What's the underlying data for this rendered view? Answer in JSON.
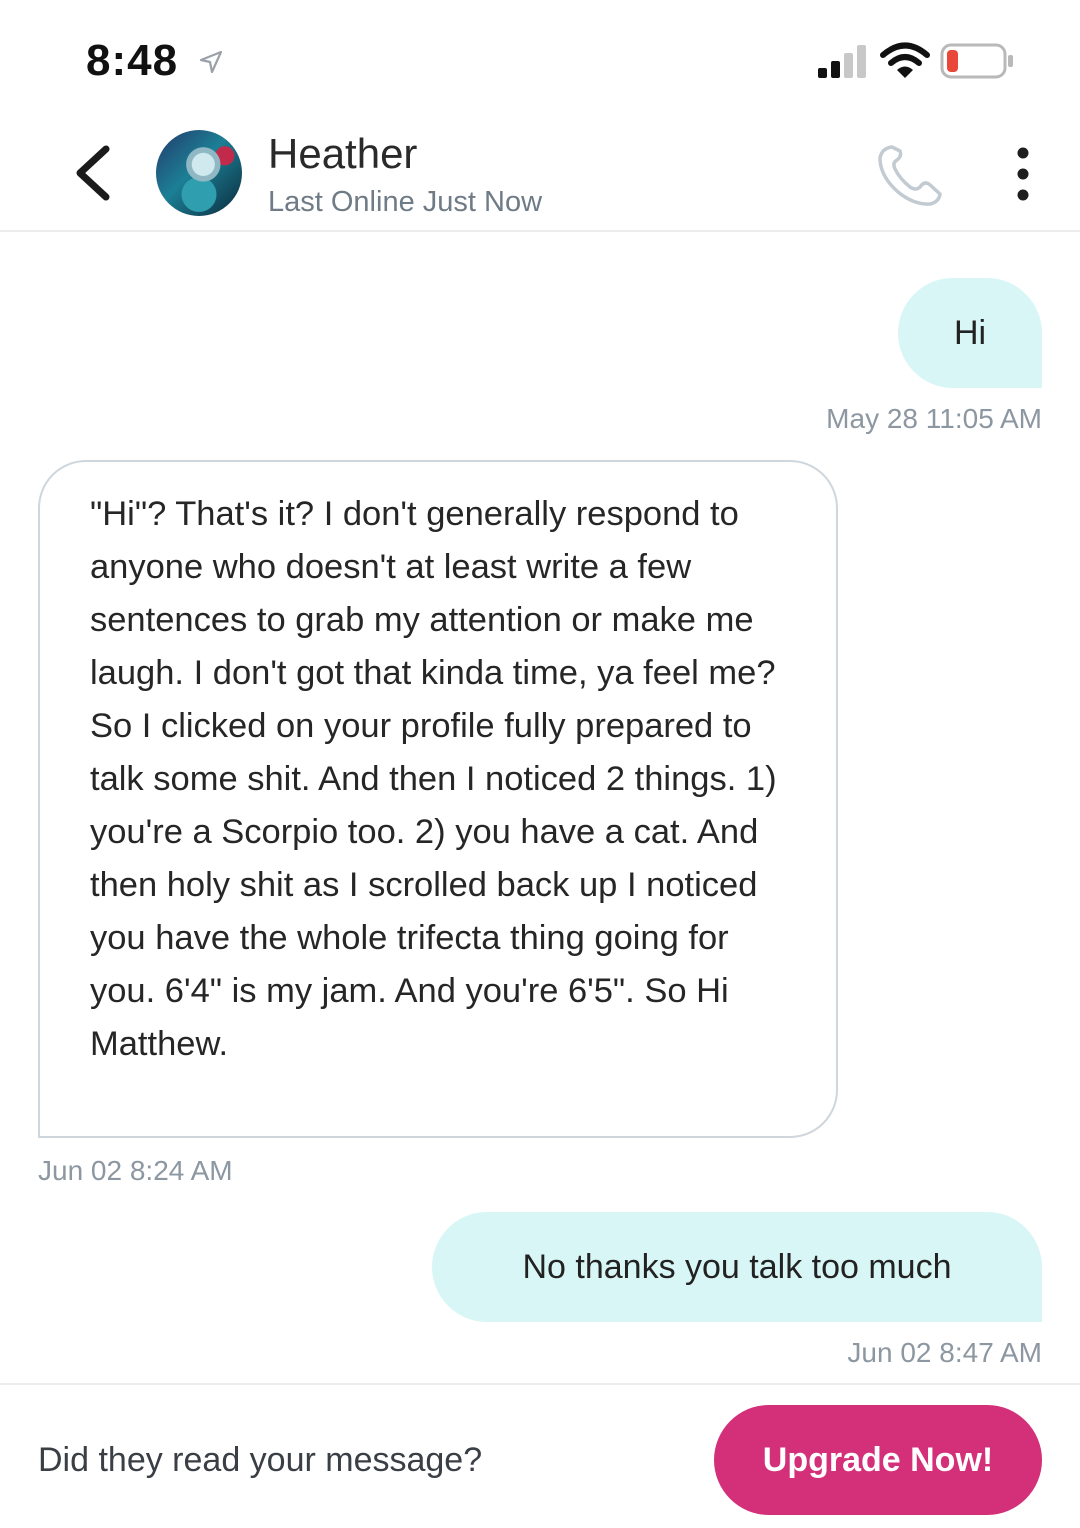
{
  "status_bar": {
    "time": "8:48",
    "icons": [
      "location-arrow-icon",
      "cell-signal-icon",
      "wifi-icon",
      "battery-low-icon"
    ],
    "battery_color": "#e8473a"
  },
  "header": {
    "contact_name": "Heather",
    "contact_status": "Last Online Just Now",
    "icons": [
      "back-chevron-icon",
      "avatar",
      "phone-icon",
      "more-vertical-icon"
    ]
  },
  "messages": [
    {
      "direction": "outgoing",
      "text": "Hi",
      "timestamp": "May 28 11:05 AM"
    },
    {
      "direction": "incoming",
      "text": "\"Hi\"? That's it? I don't generally respond to anyone who doesn't at least write a few sentences to grab my attention or make me laugh. I don't got that kinda time, ya feel me? So I clicked on your profile fully prepared to talk some shit. And then I noticed 2 things. 1) you're a Scorpio too. 2) you have a cat. And then holy shit as I scrolled back up I noticed you have the whole trifecta thing going for you. 6'4\" is my jam. And you're 6'5\". So Hi Matthew.",
      "timestamp": "Jun 02 8:24 AM"
    },
    {
      "direction": "outgoing",
      "text": "No thanks you talk too much",
      "timestamp": "Jun 02 8:47 AM"
    }
  ],
  "footer": {
    "prompt": "Did they read your message?",
    "upgrade_label": "Upgrade Now!"
  },
  "colors": {
    "outgoing_bubble": "#d8f6f6",
    "incoming_border": "#cfd6dc",
    "accent": "#d4307a",
    "timestamp": "#8c97a1"
  }
}
